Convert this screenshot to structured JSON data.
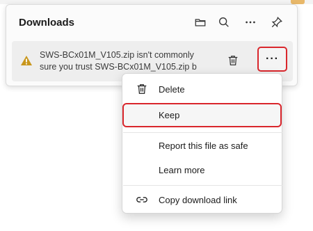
{
  "panel": {
    "title": "Downloads",
    "header_icons": [
      "folder-icon",
      "search-icon",
      "more-options-icon",
      "pin-icon"
    ]
  },
  "download_item": {
    "status_icon": "warning-icon",
    "line1": "SWS-BCx01M_V105.zip isn't commonly",
    "line2": "sure you trust SWS-BCx01M_V105.zip b",
    "more_label": "···",
    "delete_icon": "trash-icon"
  },
  "context_menu": {
    "items": [
      {
        "label": "Delete",
        "icon": "trash-icon"
      },
      {
        "label": "Keep"
      },
      {
        "label": "Report this file as safe"
      },
      {
        "label": "Learn more"
      },
      {
        "label": "Copy download link",
        "icon": "link-icon"
      }
    ]
  },
  "colors": {
    "highlight_border": "#d9262c",
    "warning": "#c8961c",
    "panel_bg": "#fbfbfb",
    "item_bg": "#eeeeee"
  }
}
